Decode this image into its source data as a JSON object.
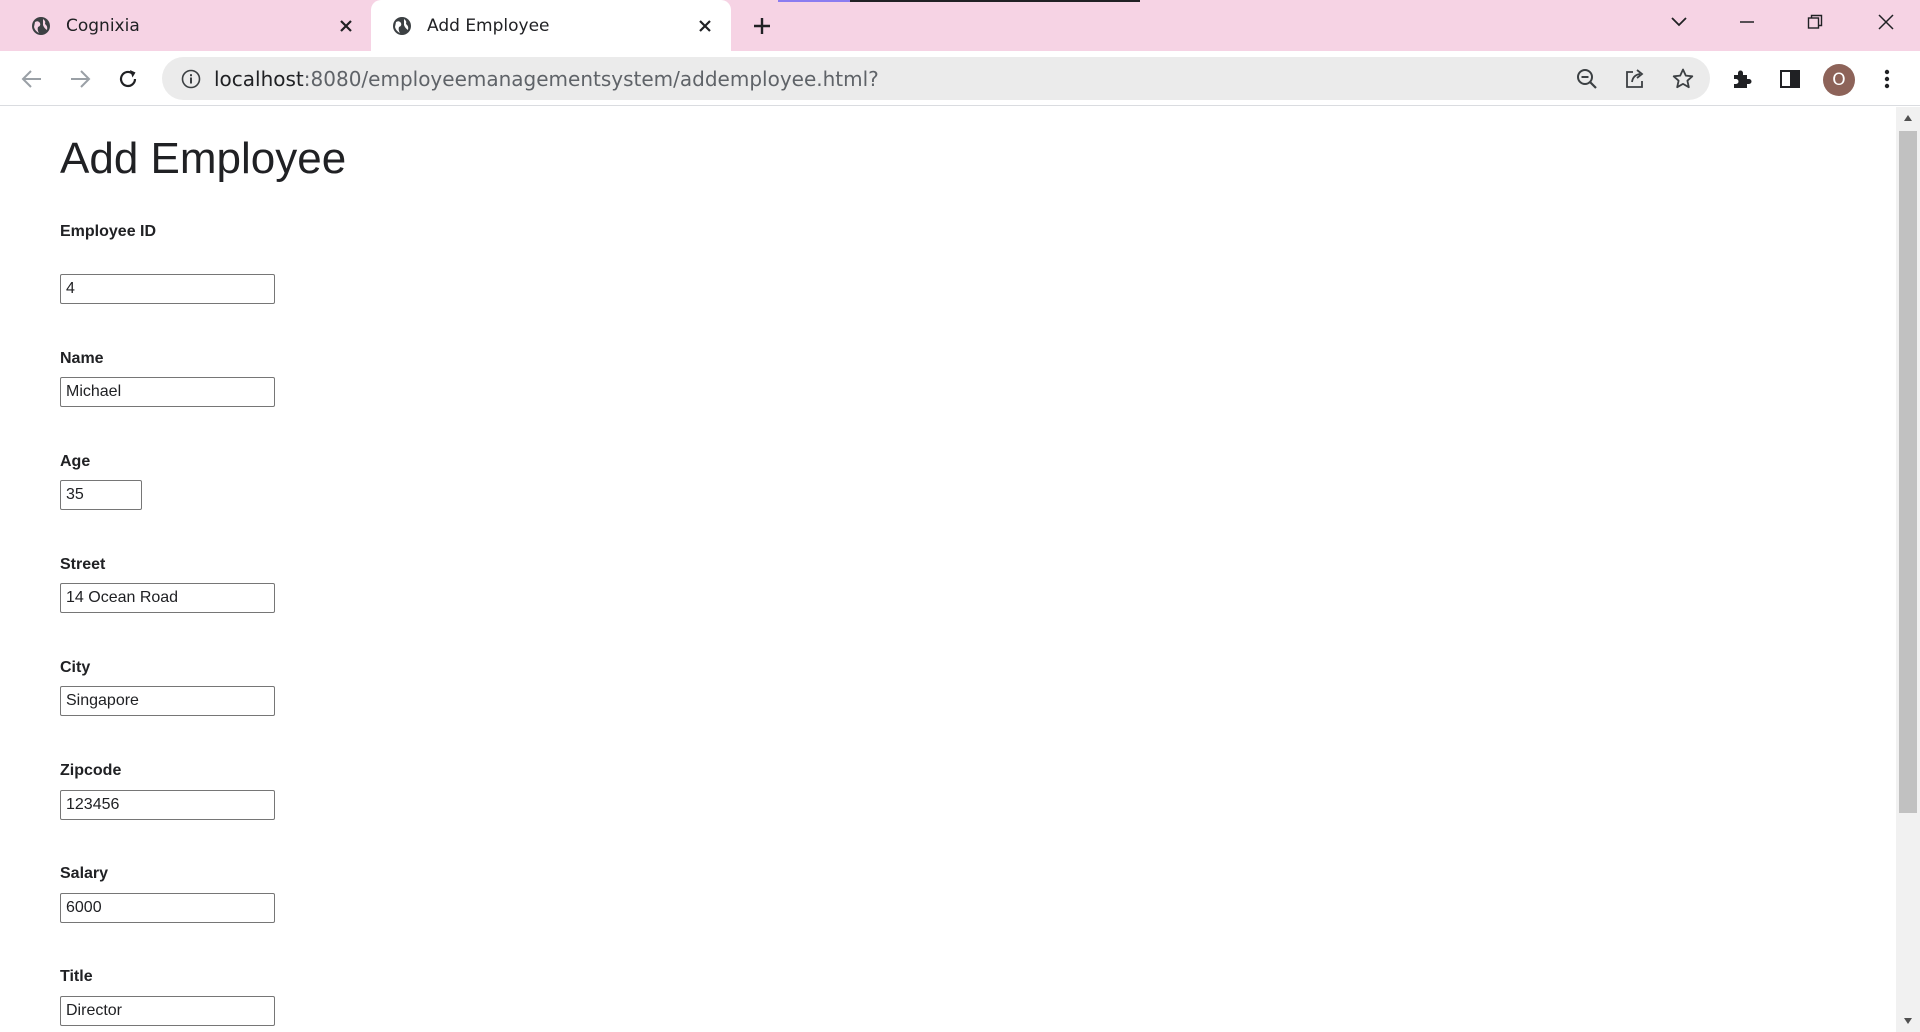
{
  "browser": {
    "tabs": [
      {
        "title": "Cognixia",
        "active": false
      },
      {
        "title": "Add Employee",
        "active": true
      }
    ],
    "url_host": "localhost",
    "url_rest": ":8080/employeemanagementsystem/addemployee.html?",
    "profile_initial": "O"
  },
  "page": {
    "heading": "Add Employee",
    "fields": [
      {
        "label": "Employee ID",
        "value": "4"
      },
      {
        "label": "Name",
        "value": "Michael"
      },
      {
        "label": "Age",
        "value": "35"
      },
      {
        "label": "Street",
        "value": "14 Ocean Road"
      },
      {
        "label": "City",
        "value": "Singapore"
      },
      {
        "label": "Zipcode",
        "value": "123456"
      },
      {
        "label": "Salary",
        "value": "6000"
      },
      {
        "label": "Title",
        "value": "Director"
      }
    ]
  },
  "colors": {
    "tabstrip": "#f6d3e4",
    "avatar": "#8d6359"
  }
}
